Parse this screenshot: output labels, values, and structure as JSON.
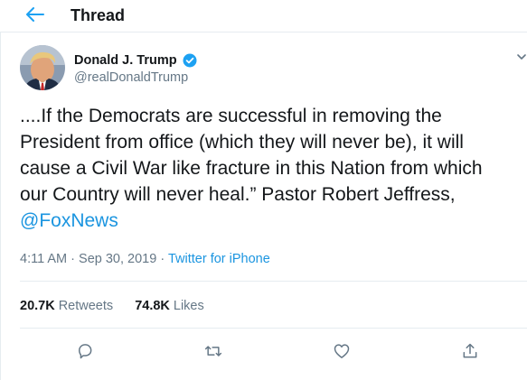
{
  "header": {
    "title": "Thread",
    "back_icon": "arrow-left-icon"
  },
  "colors": {
    "accent": "#1b95e0",
    "text": "#14171a",
    "secondary": "#657786",
    "border": "#e6ecf0"
  },
  "tweet": {
    "author": {
      "name": "Donald J. Trump",
      "handle": "@realDonaldTrump",
      "verified_icon": "verified-badge-icon"
    },
    "text_lines": [
      "....If the Democrats are successful in removing the",
      "President from office (which they will never be), it will",
      "cause a Civil War like fracture in this Nation from which",
      "our Country will never heal.” Pastor Robert Jeffress,"
    ],
    "mention": "@FoxNews",
    "time": "4:11 AM",
    "separator": "·",
    "date": "Sep 30, 2019",
    "source": "Twitter for iPhone"
  },
  "stats": {
    "retweets_count": "20.7K",
    "retweets_label": "Retweets",
    "likes_count": "74.8K",
    "likes_label": "Likes"
  },
  "actions": [
    {
      "name": "reply",
      "icon": "reply-icon"
    },
    {
      "name": "retweet",
      "icon": "retweet-icon"
    },
    {
      "name": "like",
      "icon": "heart-icon"
    },
    {
      "name": "share",
      "icon": "share-icon"
    }
  ]
}
